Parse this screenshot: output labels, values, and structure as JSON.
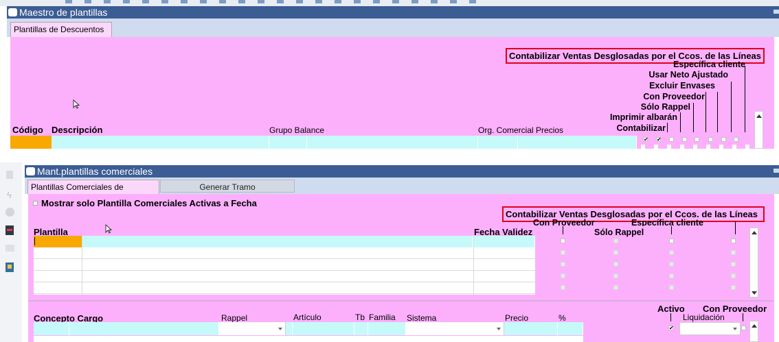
{
  "window1": {
    "title": "Maestro de plantillas",
    "tab": "Plantillas de Descuentos",
    "highlight": "Contabilizar Ventas Desglosadas por el Ccos. de las Líneas",
    "vertical_headers": [
      "Específica cliente",
      "Usar Neto Ajustado",
      "Excluir Envases",
      "Con Proveedor",
      "Sólo Rappel",
      "Imprimir albarán",
      "Contabilizar"
    ],
    "columns": {
      "codigo": "Código",
      "descripcion": "Descripción",
      "grupo_balance": "Grupo Balance",
      "org_comercial": "Org. Comercial Precios"
    }
  },
  "window2": {
    "title": "Mant.plantillas comerciales",
    "tabs": [
      "Plantillas Comerciales de Provisión",
      "Generar Tramo"
    ],
    "checkbox_label": "Mostrar solo Plantilla Comerciales Activas a Fecha",
    "highlight": "Contabilizar Ventas Desglosadas por el Ccos. de las Líneas",
    "header_labels": {
      "con_proveedor": "Con Proveedor",
      "especifica_cliente": "Específica cliente",
      "solo_rappel": "Sólo Rappel"
    },
    "columns": {
      "plantilla": "Plantilla",
      "fecha_validez": "Fecha Validez"
    },
    "lower_columns": [
      "Concepto Cargo",
      "Rappel",
      "Artículo",
      "Tb",
      "Familia",
      "Sistema",
      "Precio",
      "%"
    ],
    "lower_right": {
      "activo": "Activo",
      "con_proveedor": "Con Proveedor",
      "liquidacion": "Liquidación"
    }
  },
  "colors": {
    "titlebar": "#3c5c94",
    "pink": "#fcb0fc",
    "highlight_border": "#e0001a",
    "current_cell": "#f8a800",
    "field": "#c6fafa"
  }
}
